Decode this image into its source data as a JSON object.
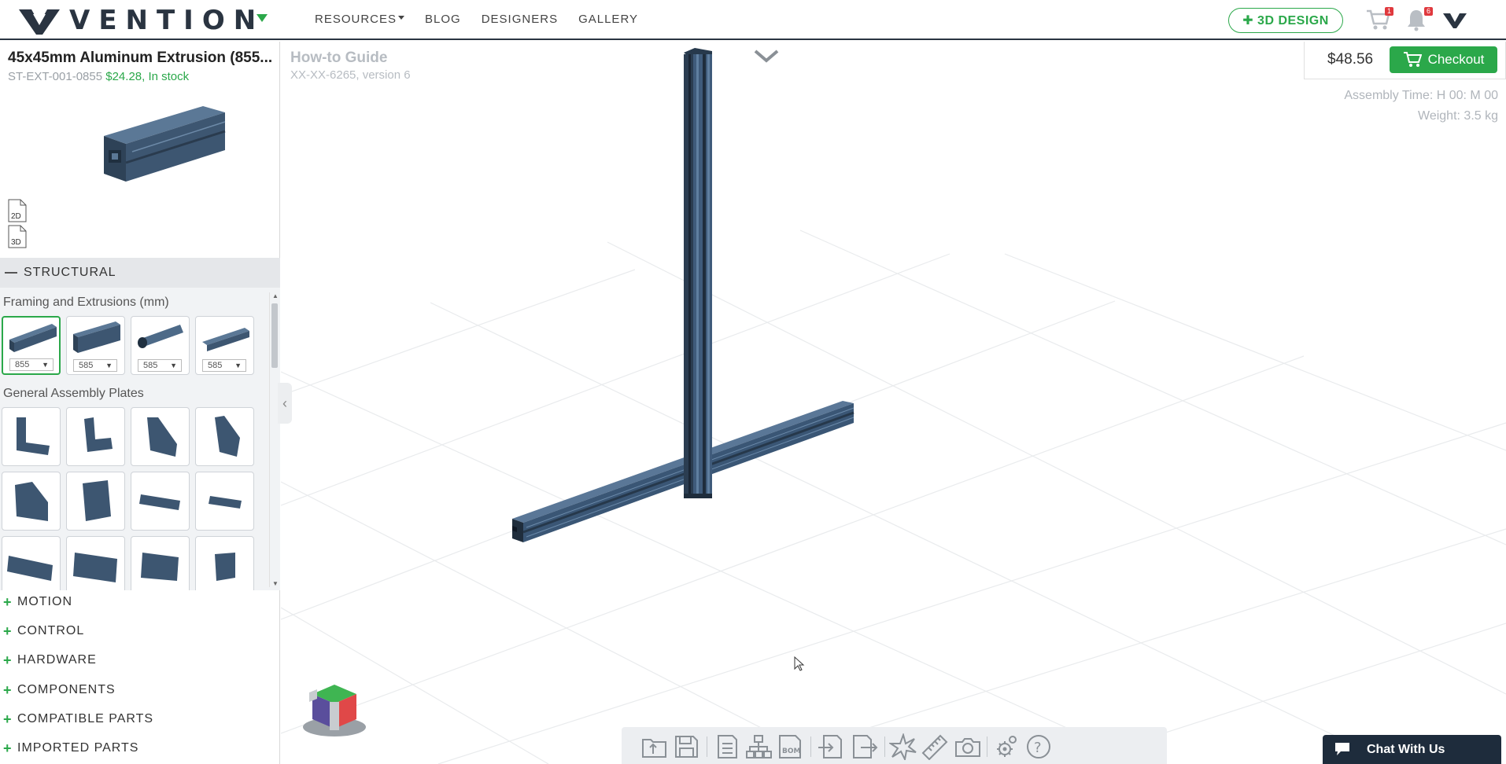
{
  "brand": {
    "name": "VENTION"
  },
  "nav": {
    "items": [
      {
        "label": "RESOURCES",
        "has_caret": true
      },
      {
        "label": "BLOG"
      },
      {
        "label": "DESIGNERS"
      },
      {
        "label": "GALLERY"
      }
    ],
    "design_button": "✚ 3D DESIGN",
    "cart_count": "1",
    "notification_count": "6"
  },
  "part": {
    "title": "45x45mm Aluminum Extrusion (855...",
    "sku": "ST-EXT-001-0855",
    "price": "$24.28, In stock",
    "doc_2d": "2D",
    "doc_3d": "3D"
  },
  "catalog": {
    "section_label": "STRUCTURAL",
    "groups": [
      {
        "title": "Framing and Extrusions (mm)",
        "lengths": [
          "855",
          "585",
          "585",
          "585"
        ]
      },
      {
        "title": "General Assembly Plates"
      }
    ],
    "categories": [
      "MOTION",
      "CONTROL",
      "HARDWARE",
      "COMPONENTS",
      "COMPATIBLE PARTS",
      "IMPORTED PARTS"
    ]
  },
  "viewport": {
    "guide_title": "How-to Guide",
    "guide_sub": "XX-XX-6265, version 6",
    "total_price": "$48.56",
    "checkout_label": "Checkout",
    "assembly_time": "Assembly Time: H 00: M 00",
    "weight": "Weight: 3.5 kg",
    "chat_label": "Chat With Us"
  },
  "colors": {
    "accent": "#2ba84a",
    "navy": "#2a3441",
    "extrusion": "#3f5a78"
  },
  "toolbar_icons": [
    "open-folder-icon",
    "save-icon",
    "part-list-icon",
    "hierarchy-icon",
    "bom-icon",
    "import-icon",
    "export-icon",
    "explode-icon",
    "ruler-icon",
    "camera-icon",
    "settings-icon",
    "help-icon"
  ]
}
